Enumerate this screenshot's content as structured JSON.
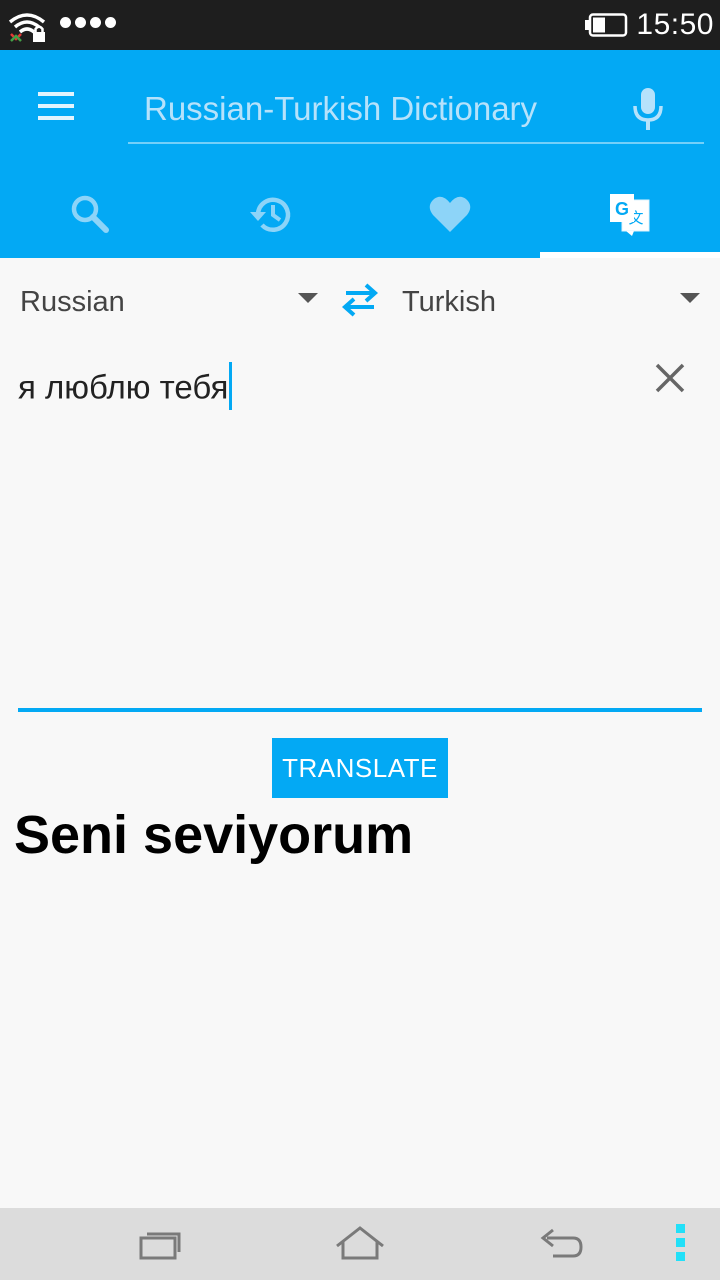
{
  "status_bar": {
    "time": "15:50",
    "wifi_icon": "wifi-lock-icon",
    "signal_icon": "signal-dots-icon",
    "battery_icon": "battery-icon",
    "signal_dot_count": 4
  },
  "app_bar": {
    "menu_icon": "hamburger-menu-icon",
    "search_placeholder": "Russian-Turkish Dictionary",
    "search_value": "",
    "mic_icon": "microphone-icon",
    "background_color": "#03a9f4"
  },
  "tabs": [
    {
      "icon": "search-icon",
      "active": false
    },
    {
      "icon": "history-icon",
      "active": false
    },
    {
      "icon": "heart-icon",
      "active": false
    },
    {
      "icon": "google-translate-icon",
      "active": true
    }
  ],
  "translator": {
    "source_language": "Russian",
    "target_language": "Turkish",
    "swap_icon": "swap-arrows-icon",
    "input_text": "я люблю тебя",
    "clear_icon": "close-icon",
    "translate_label": "TRANSLATE",
    "result_text": "Seni seviyorum"
  },
  "nav_bar": {
    "recents_icon": "recent-apps-icon",
    "home_icon": "home-icon",
    "back_icon": "back-icon",
    "more_icon": "more-dots-icon"
  },
  "colors": {
    "accent": "#03a9f4",
    "status_bar": "#1e1e1e",
    "nav_bar": "#dcdcdc",
    "nav_more": "#22e0f8"
  }
}
